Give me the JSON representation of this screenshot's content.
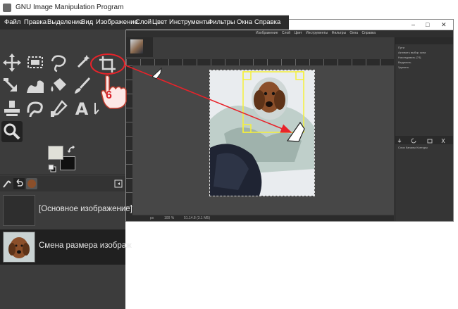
{
  "window": {
    "title": "GNU Image Manipulation Program"
  },
  "menu": [
    "Файл",
    "Правка",
    "Выделение",
    "Вид",
    "Изображение",
    "Слой",
    "Цвет",
    "Инструменты",
    "Фильтры",
    "Окна",
    "Справка"
  ],
  "bg_window": {
    "menu": [
      "Изображение",
      "Слой",
      "Цвет",
      "Инструменты",
      "Фильтры",
      "Окна",
      "Справка"
    ],
    "controls": {
      "minimize": "–",
      "maximize": "□",
      "close": "✕"
    },
    "right_panel": {
      "header": "Пути",
      "items": [
        "Активить выбор окна",
        "Наследовать (74)",
        "Выделить",
        "Удалить"
      ],
      "tabs": [
        "Слои",
        "Каналы",
        "Контуры"
      ]
    },
    "statusbar": {
      "unit": "px",
      "zoom": "100 %",
      "info": "51.14.8 (3.1 МБ)"
    }
  },
  "history": {
    "items": [
      {
        "label": "[Основное изображение]"
      },
      {
        "label": "Смена размера изображ"
      }
    ]
  },
  "annotation": {
    "step_number": "6"
  },
  "colors": {
    "accent_red": "#e8232a",
    "selection_yellow": "#f5f03a",
    "panel": "#3c3c3c"
  },
  "icons": [
    "move-icon",
    "rect-select-icon",
    "free-select-icon",
    "fuzzy-select-icon",
    "crop-icon",
    "transform-icon",
    "warp-icon",
    "bucket-fill-icon",
    "paintbrush-icon",
    "clone-icon",
    "smudge-icon",
    "color-picker-icon",
    "text-icon",
    "zoom-icon",
    "swap-colors-icon",
    "reset-colors-icon",
    "undo-history-icon",
    "tool-options-icon",
    "images-icon"
  ]
}
